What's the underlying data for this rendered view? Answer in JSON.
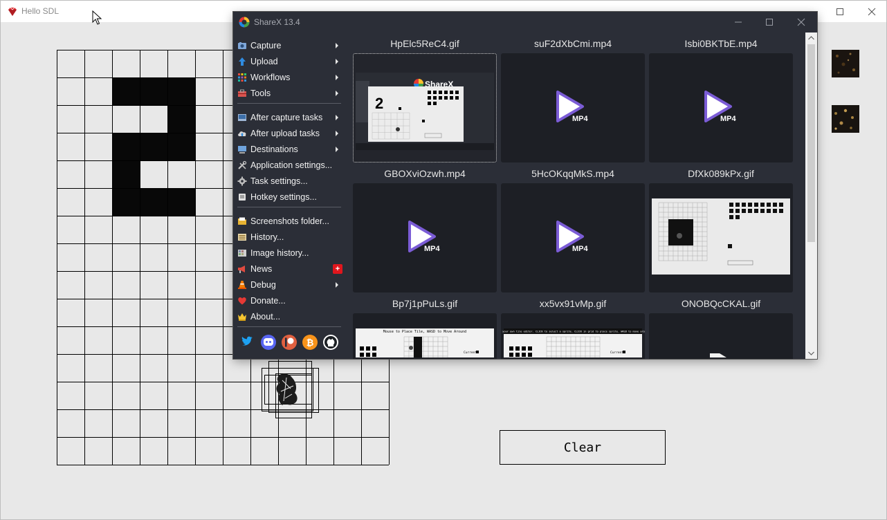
{
  "sdl": {
    "title": "Hello SDL",
    "clear_label": "Clear",
    "filled_cells": [
      [
        2,
        1
      ],
      [
        3,
        1
      ],
      [
        4,
        1
      ],
      [
        4,
        2
      ],
      [
        2,
        3
      ],
      [
        3,
        3
      ],
      [
        4,
        3
      ],
      [
        2,
        4
      ],
      [
        2,
        5
      ],
      [
        3,
        5
      ],
      [
        4,
        5
      ]
    ],
    "grid_cols": 12,
    "grid_rows": 15
  },
  "sharex": {
    "title": "ShareX 13.4",
    "menu": [
      {
        "label": "Capture",
        "icon": "camera-icon",
        "arrow": true
      },
      {
        "label": "Upload",
        "icon": "upload-arrow-icon",
        "arrow": true
      },
      {
        "label": "Workflows",
        "icon": "workflows-grid-icon",
        "arrow": true
      },
      {
        "label": "Tools",
        "icon": "toolbox-icon",
        "arrow": true
      },
      {
        "label": "After capture tasks",
        "icon": "after-capture-icon",
        "arrow": true
      },
      {
        "label": "After upload tasks",
        "icon": "cloud-upload-icon",
        "arrow": true
      },
      {
        "label": "Destinations",
        "icon": "destinations-icon",
        "arrow": true
      },
      {
        "label": "Application settings...",
        "icon": "wrench-screwdriver-icon",
        "arrow": false
      },
      {
        "label": "Task settings...",
        "icon": "gear-icon",
        "arrow": false
      },
      {
        "label": "Hotkey settings...",
        "icon": "keyboard-key-icon",
        "arrow": false
      },
      {
        "label": "Screenshots folder...",
        "icon": "folder-icon",
        "arrow": false
      },
      {
        "label": "History...",
        "icon": "history-list-icon",
        "arrow": false
      },
      {
        "label": "Image history...",
        "icon": "image-history-icon",
        "arrow": false
      },
      {
        "label": "News",
        "icon": "megaphone-icon",
        "arrow": false,
        "badge": "+"
      },
      {
        "label": "Debug",
        "icon": "traffic-cone-icon",
        "arrow": true
      },
      {
        "label": "Donate...",
        "icon": "heart-icon",
        "arrow": false
      },
      {
        "label": "About...",
        "icon": "crown-icon",
        "arrow": false
      }
    ],
    "social": [
      "twitter-icon",
      "discord-icon",
      "patreon-icon",
      "bitcoin-icon",
      "github-icon"
    ],
    "thumbnails": [
      {
        "name": "HpElc5ReC4.gif",
        "kind": "gif-sharex",
        "selected": true
      },
      {
        "name": "suF2dXbCmi.mp4",
        "kind": "mp4"
      },
      {
        "name": "Isbi0BKTbE.mp4",
        "kind": "mp4"
      },
      {
        "name": "GBOXviOzwh.mp4",
        "kind": "mp4"
      },
      {
        "name": "5HcOKqqMkS.mp4",
        "kind": "mp4"
      },
      {
        "name": "DfXk089kPx.gif",
        "kind": "gif-app"
      },
      {
        "name": "Bp7j1pPuLs.gif",
        "kind": "gif-editor"
      },
      {
        "name": "xx5vx91vMp.gif",
        "kind": "gif-editor2"
      },
      {
        "name": "ONOBQcCKAL.gif",
        "kind": "gif-dark"
      }
    ],
    "mp4_badge": "MP4",
    "thumb_text": {
      "sharex_logo": "ShareX",
      "editor_caption": "Mouse to Place Tile, WASD to Move Around",
      "editor2_caption": "Roll your own tile editor. CLICK to select a sprite. CLICK in grid to place sprite. WASD to move around.",
      "current_label": "Current:",
      "clear_small": "Clear"
    }
  }
}
